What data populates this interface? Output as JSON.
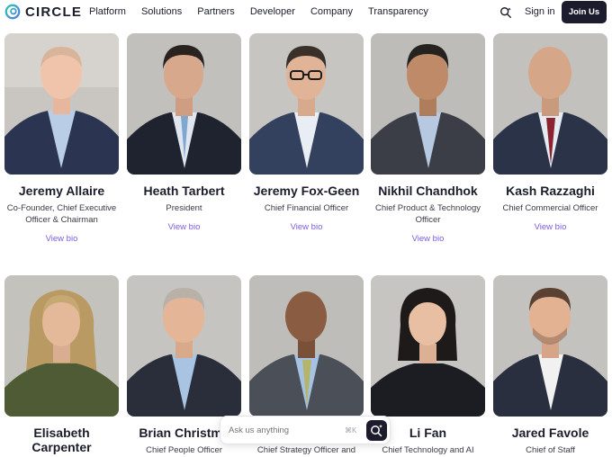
{
  "brand": {
    "name": "CIRCLE"
  },
  "nav": {
    "items": [
      "Platform",
      "Solutions",
      "Partners",
      "Developer",
      "Company",
      "Transparency"
    ],
    "signin": "Sign in",
    "join": "Join Us"
  },
  "team": [
    {
      "name": "Jeremy Allaire",
      "role": "Co-Founder, Chief Executive Officer & Chairman",
      "link": "View bio"
    },
    {
      "name": "Heath Tarbert",
      "role": "President",
      "link": "View bio"
    },
    {
      "name": "Jeremy Fox-Geen",
      "role": "Chief Financial Officer",
      "link": "View bio"
    },
    {
      "name": "Nikhil Chandhok",
      "role": "Chief Product & Technology Officer",
      "link": "View bio"
    },
    {
      "name": "Kash Razzaghi",
      "role": "Chief Commercial Officer",
      "link": "View bio"
    },
    {
      "name": "Elisabeth Carpenter",
      "role": "",
      "link": ""
    },
    {
      "name": "Brian Christma",
      "role": "Chief People Officer",
      "link": ""
    },
    {
      "name": "",
      "role": "Chief Strategy Officer and",
      "link": ""
    },
    {
      "name": "Li Fan",
      "role": "Chief Technology and AI",
      "link": ""
    },
    {
      "name": "Jared Favole",
      "role": "Chief of Staff",
      "link": ""
    }
  ],
  "ask": {
    "placeholder": "Ask us anything",
    "shortcut": "⌘K"
  },
  "colors": {
    "accent": "#7b5ce0",
    "dark": "#1d1b2e",
    "logo_blue": "#4aa3d9",
    "logo_teal": "#35c2b5"
  }
}
